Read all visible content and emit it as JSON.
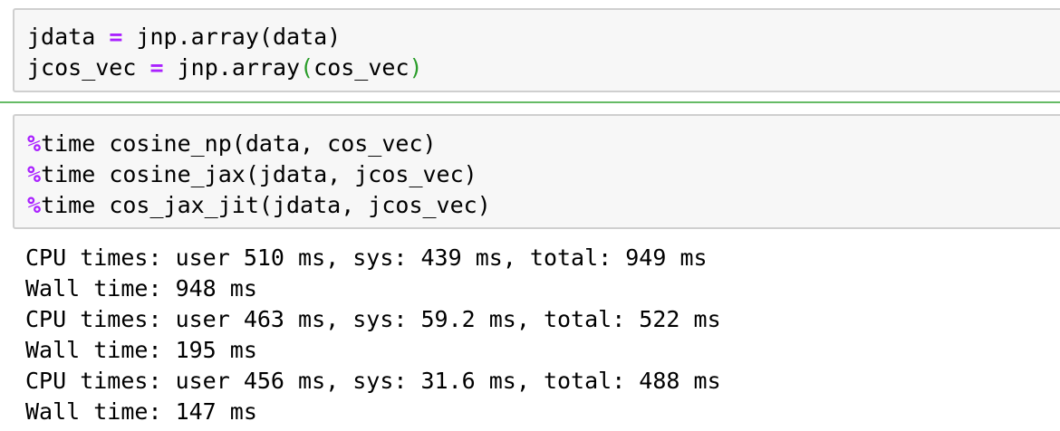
{
  "cells": [
    {
      "lines": [
        {
          "var": "jdata",
          "op": "=",
          "rest": "jnp.array(data)"
        },
        {
          "var": "jcos_vec",
          "op": "=",
          "call": "jnp.array",
          "open": "(",
          "arg": "cos_vec",
          "close": ")"
        }
      ]
    },
    {
      "lines": [
        {
          "magic": "%",
          "code": "time cosine_np(data, cos_vec)"
        },
        {
          "magic": "%",
          "code": "time cosine_jax(jdata, jcos_vec)"
        },
        {
          "magic": "%",
          "code": "time cos_jax_jit(jdata, jcos_vec)"
        }
      ]
    }
  ],
  "output": [
    "CPU times: user 510 ms, sys: 439 ms, total: 949 ms",
    "Wall time: 948 ms",
    "CPU times: user 463 ms, sys: 59.2 ms, total: 522 ms",
    "Wall time: 195 ms",
    "CPU times: user 456 ms, sys: 31.6 ms, total: 488 ms",
    "Wall time: 147 ms"
  ],
  "colors": {
    "operator": "#aa22ff",
    "matched_paren": "#2a9d2a",
    "cell_background": "#f7f7f7",
    "cell_border": "#cfcfcf",
    "selected_cell_divider": "#66bb66"
  }
}
